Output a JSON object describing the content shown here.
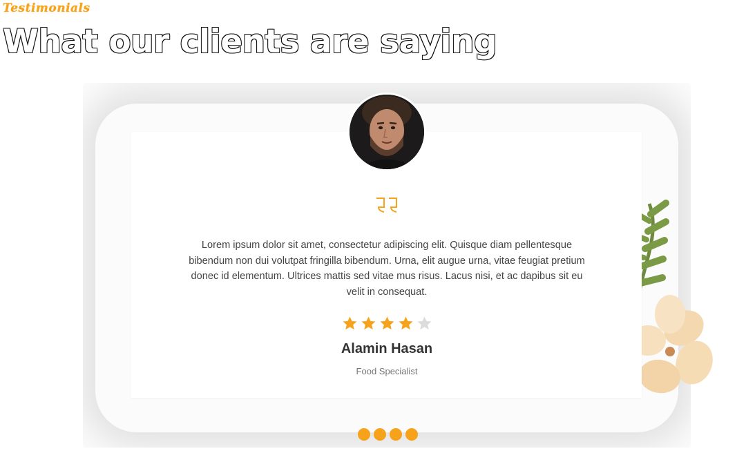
{
  "section": {
    "eyebrow": "Testimonials",
    "heading": "What our clients are saying"
  },
  "testimonial": {
    "text": "Lorem ipsum dolor sit amet, consectetur adipiscing elit. Quisque diam pellentesque bibendum non dui volutpat fringilla bibendum. Urna, elit augue urna, vitae feugiat pretium donec id elementum. Ultrices mattis sed vitae mus risus. Lacus nisi, et ac dapibus sit eu velit in consequat.",
    "name": "Alamin Hasan",
    "role": "Food Specialist",
    "rating": 4,
    "rating_max": 5
  },
  "icons": {
    "quote": "quote-icon",
    "star": "star-icon",
    "avatar": "avatar"
  },
  "colors": {
    "accent": "#f7a21b",
    "star_empty": "#dcdcdc",
    "text": "#444444",
    "name": "#333333",
    "role": "#777777"
  },
  "carousel": {
    "slide_count": 4
  }
}
